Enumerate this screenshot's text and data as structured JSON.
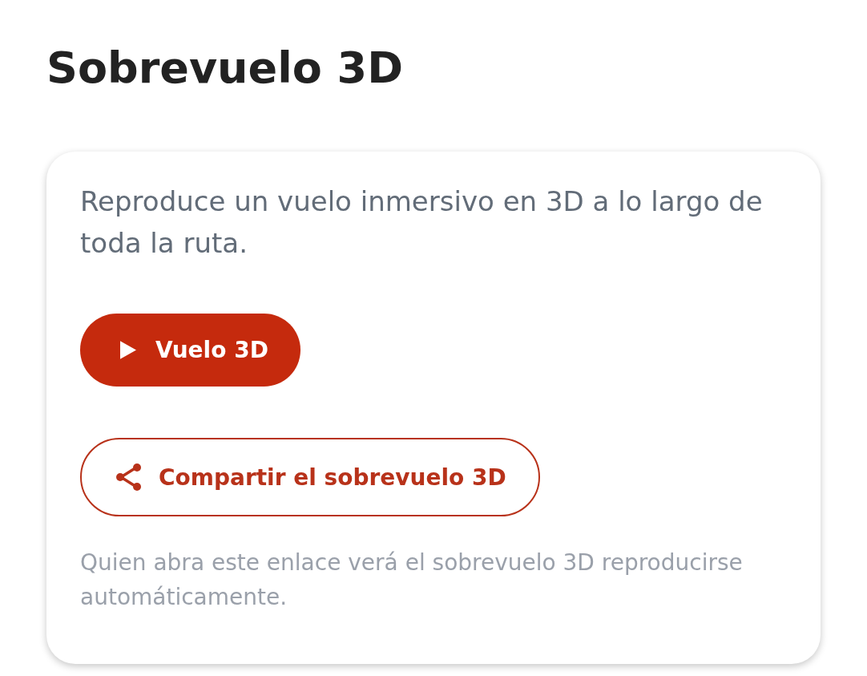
{
  "title": "Sobrevuelo 3D",
  "card": {
    "description": "Reproduce un vuelo inmersivo en 3D a lo largo de toda la ruta.",
    "buttons": [
      {
        "kind": "play",
        "label": "Vuelo 3D"
      },
      {
        "kind": "share",
        "label": "Compartir el sobrevuelo 3D"
      }
    ],
    "note": "Quien abra este enlace verá el sobrevuelo 3D reproducirse automáticamente."
  }
}
